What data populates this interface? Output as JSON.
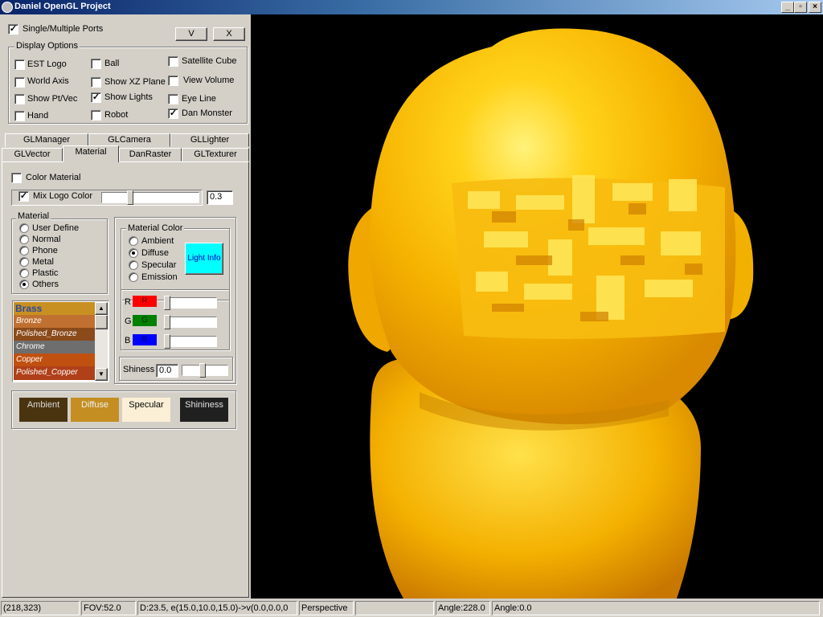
{
  "window": {
    "title": "Daniel OpenGL Project",
    "controls": [
      "_",
      "▫",
      "×"
    ]
  },
  "top": {
    "single_multiple_ports": "Single/Multiple Ports",
    "v_button": "V",
    "x_button": "X"
  },
  "display_options": {
    "legend": "Display Options",
    "items": [
      {
        "label": "EST Logo",
        "checked": false
      },
      {
        "label": "World Axis",
        "checked": false
      },
      {
        "label": "Show Pt/Vec",
        "checked": false
      },
      {
        "label": "Hand",
        "checked": false
      },
      {
        "label": "Ball",
        "checked": false
      },
      {
        "label": "Show XZ Plane",
        "checked": false
      },
      {
        "label": "Show Lights",
        "checked": true
      },
      {
        "label": "Robot",
        "checked": false
      },
      {
        "label": "Satellite Cube",
        "checked": false
      },
      {
        "label": "View Volume",
        "checked": false
      },
      {
        "label": "Eye Line",
        "checked": false
      },
      {
        "label": "Dan Monster",
        "checked": true
      }
    ]
  },
  "tabs": {
    "row1": [
      "GLManager",
      "GLCamera",
      "GLLighter"
    ],
    "row2": [
      "GLVector",
      "Material",
      "DanRaster",
      "GLTexturer"
    ],
    "active": "Material"
  },
  "material_tab": {
    "color_material": "Color Material",
    "mix_logo_color": "Mix Logo Color",
    "mix_value": "0.3",
    "material": {
      "legend": "Material",
      "options": [
        "User Define",
        "Normal",
        "Phone",
        "Metal",
        "Plastic",
        "Others"
      ],
      "selected": "Others"
    },
    "material_color": {
      "legend": "Material Color",
      "options": [
        "Ambient",
        "Diffuse",
        "Specular",
        "Emission"
      ],
      "selected": "Diffuse",
      "light_info": "Light Info"
    },
    "rgb": {
      "r_label": "R",
      "r_value": "R",
      "r_color": "#ff0000",
      "g_label": "G",
      "g_value": "G",
      "g_color": "#008000",
      "b_label": "B",
      "b_value": "B",
      "b_color": "#0000ff"
    },
    "shininess": {
      "label": "Shiness",
      "value": "0.0"
    },
    "material_list": {
      "header": "Brass",
      "items": [
        {
          "name": "Bronze",
          "color": "#c07030"
        },
        {
          "name": "Polished_Bronze",
          "color": "#8a4a1a"
        },
        {
          "name": "Chrome",
          "color": "#6e6e6e"
        },
        {
          "name": "Copper",
          "color": "#c05010"
        },
        {
          "name": "Polished_Copper",
          "color": "#b0401a"
        }
      ]
    },
    "swatches": {
      "ambient": {
        "label": "Ambient",
        "color": "#4a3410",
        "text": "#d8d8d8"
      },
      "diffuse": {
        "label": "Diffuse",
        "color": "#c48e22",
        "text": "#f0f0f0"
      },
      "specular": {
        "label": "Specular",
        "color": "#fbf0d6",
        "text": "#000000"
      },
      "shininess": {
        "label": "Shininess",
        "color": "#202020",
        "text": "#e0e0e0"
      }
    }
  },
  "status": {
    "coords": "(218,323)",
    "fov": "FOV:52.0",
    "distance": "D:23.5, e(15.0,10.0,15.0)->v(0.0,0.0,0",
    "projection": "Perspective",
    "angle1": "Angle:228.0",
    "angle2": "Angle:0.0"
  }
}
